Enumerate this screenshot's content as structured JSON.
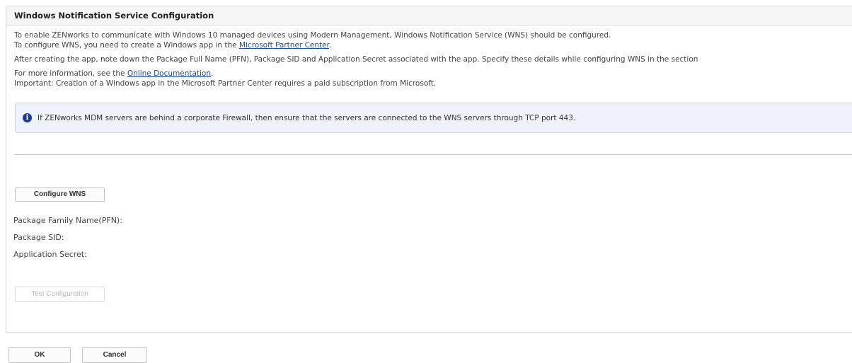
{
  "panel": {
    "title": "Windows Notification Service Configuration"
  },
  "intro": {
    "line1": "To enable ZENworks to communicate with Windows 10 managed devices using Modern Management, Windows Notification Service (WNS) should be configured.",
    "line2_prefix": "To configure WNS, you need to create a Windows app in the ",
    "line2_link": "Microsoft Partner Center",
    "line2_suffix": ".",
    "line3": "After creating the app, note down the Package Full Name (PFN), Package SID and Application Secret associated with the app. Specify these details while configuring WNS in the section",
    "line4_prefix": "For more information, see the ",
    "line4_link": "Online Documentation",
    "line4_suffix": ".",
    "line5": "Important: Creation of a Windows app in the Microsoft Partner Center requires a paid subscription from Microsoft."
  },
  "info": {
    "icon": "info-icon",
    "text": "If ZENworks MDM servers are behind a corporate Firewall, then ensure that the servers are connected to the WNS servers through TCP port 443."
  },
  "config": {
    "configure_button": "Configure WNS",
    "pfn_label": "Package Family Name(PFN):",
    "sid_label": "Package SID:",
    "secret_label": "Application Secret:",
    "test_button": "Test Configuration"
  },
  "footer": {
    "ok_button": "OK",
    "cancel_button": "Cancel"
  }
}
